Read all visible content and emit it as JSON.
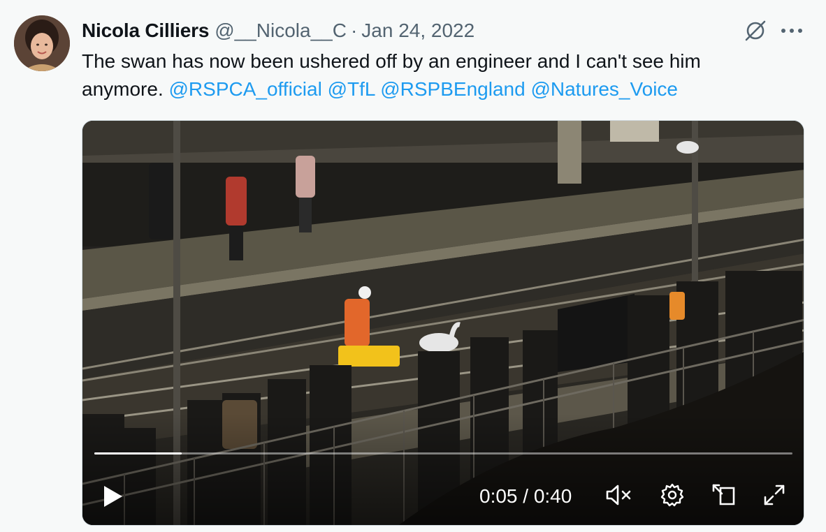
{
  "tweet": {
    "author_name": "Nicola Cilliers",
    "author_handle": "@__Nicola__C",
    "separator": "·",
    "date": "Jan 24, 2022",
    "text_part1": "The swan has now been ushered off by an engineer and I can't see him anymore. ",
    "mentions": [
      "@RSPCA_official",
      "@TfL",
      "@RSPBEngland",
      "@Natures_Voice"
    ]
  },
  "header_icons": {
    "grok": "grok-icon",
    "more": "more-icon"
  },
  "video": {
    "current_time": "0:05",
    "duration": "0:40",
    "time_display": "0:05 / 0:40",
    "progress_fraction": 0.125,
    "controls": [
      "play-icon",
      "volume-muted-icon",
      "settings-icon",
      "pop-out-icon",
      "fullscreen-icon"
    ]
  },
  "colors": {
    "link": "#1d9bf0",
    "text_primary": "#0f1419",
    "text_secondary": "#536471",
    "background": "#f7f9f9"
  }
}
